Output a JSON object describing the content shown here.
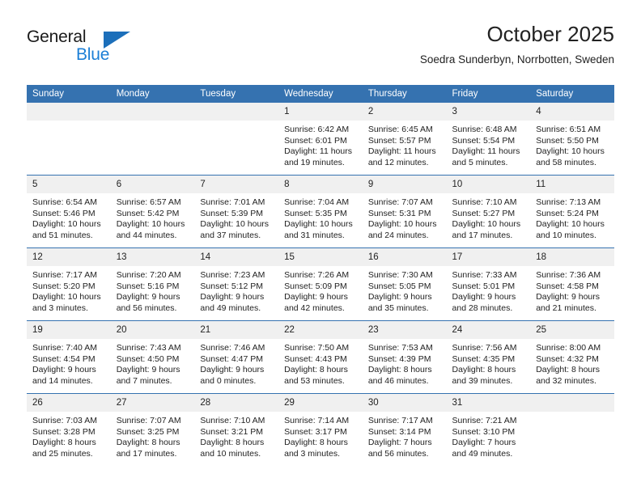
{
  "logo": {
    "word1": "General",
    "word2": "Blue",
    "triangle_color": "#1c6fba",
    "blue_color": "#1c7fd6"
  },
  "header": {
    "month_title": "October 2025",
    "location": "Soedra Sunderbyn, Norrbotten, Sweden"
  },
  "theme": {
    "header_bg": "#3572b0",
    "daynum_bg": "#f0f0f0",
    "text": "#222222"
  },
  "calendar": {
    "weekday_headers": [
      "Sunday",
      "Monday",
      "Tuesday",
      "Wednesday",
      "Thursday",
      "Friday",
      "Saturday"
    ],
    "weeks": [
      [
        {
          "day": "",
          "empty": true,
          "sunrise": "",
          "sunset": "",
          "daylight1": "",
          "daylight2": ""
        },
        {
          "day": "",
          "empty": true,
          "sunrise": "",
          "sunset": "",
          "daylight1": "",
          "daylight2": ""
        },
        {
          "day": "",
          "empty": true,
          "sunrise": "",
          "sunset": "",
          "daylight1": "",
          "daylight2": ""
        },
        {
          "day": "1",
          "sunrise": "Sunrise: 6:42 AM",
          "sunset": "Sunset: 6:01 PM",
          "daylight1": "Daylight: 11 hours",
          "daylight2": "and 19 minutes."
        },
        {
          "day": "2",
          "sunrise": "Sunrise: 6:45 AM",
          "sunset": "Sunset: 5:57 PM",
          "daylight1": "Daylight: 11 hours",
          "daylight2": "and 12 minutes."
        },
        {
          "day": "3",
          "sunrise": "Sunrise: 6:48 AM",
          "sunset": "Sunset: 5:54 PM",
          "daylight1": "Daylight: 11 hours",
          "daylight2": "and 5 minutes."
        },
        {
          "day": "4",
          "sunrise": "Sunrise: 6:51 AM",
          "sunset": "Sunset: 5:50 PM",
          "daylight1": "Daylight: 10 hours",
          "daylight2": "and 58 minutes."
        }
      ],
      [
        {
          "day": "5",
          "sunrise": "Sunrise: 6:54 AM",
          "sunset": "Sunset: 5:46 PM",
          "daylight1": "Daylight: 10 hours",
          "daylight2": "and 51 minutes."
        },
        {
          "day": "6",
          "sunrise": "Sunrise: 6:57 AM",
          "sunset": "Sunset: 5:42 PM",
          "daylight1": "Daylight: 10 hours",
          "daylight2": "and 44 minutes."
        },
        {
          "day": "7",
          "sunrise": "Sunrise: 7:01 AM",
          "sunset": "Sunset: 5:39 PM",
          "daylight1": "Daylight: 10 hours",
          "daylight2": "and 37 minutes."
        },
        {
          "day": "8",
          "sunrise": "Sunrise: 7:04 AM",
          "sunset": "Sunset: 5:35 PM",
          "daylight1": "Daylight: 10 hours",
          "daylight2": "and 31 minutes."
        },
        {
          "day": "9",
          "sunrise": "Sunrise: 7:07 AM",
          "sunset": "Sunset: 5:31 PM",
          "daylight1": "Daylight: 10 hours",
          "daylight2": "and 24 minutes."
        },
        {
          "day": "10",
          "sunrise": "Sunrise: 7:10 AM",
          "sunset": "Sunset: 5:27 PM",
          "daylight1": "Daylight: 10 hours",
          "daylight2": "and 17 minutes."
        },
        {
          "day": "11",
          "sunrise": "Sunrise: 7:13 AM",
          "sunset": "Sunset: 5:24 PM",
          "daylight1": "Daylight: 10 hours",
          "daylight2": "and 10 minutes."
        }
      ],
      [
        {
          "day": "12",
          "sunrise": "Sunrise: 7:17 AM",
          "sunset": "Sunset: 5:20 PM",
          "daylight1": "Daylight: 10 hours",
          "daylight2": "and 3 minutes."
        },
        {
          "day": "13",
          "sunrise": "Sunrise: 7:20 AM",
          "sunset": "Sunset: 5:16 PM",
          "daylight1": "Daylight: 9 hours",
          "daylight2": "and 56 minutes."
        },
        {
          "day": "14",
          "sunrise": "Sunrise: 7:23 AM",
          "sunset": "Sunset: 5:12 PM",
          "daylight1": "Daylight: 9 hours",
          "daylight2": "and 49 minutes."
        },
        {
          "day": "15",
          "sunrise": "Sunrise: 7:26 AM",
          "sunset": "Sunset: 5:09 PM",
          "daylight1": "Daylight: 9 hours",
          "daylight2": "and 42 minutes."
        },
        {
          "day": "16",
          "sunrise": "Sunrise: 7:30 AM",
          "sunset": "Sunset: 5:05 PM",
          "daylight1": "Daylight: 9 hours",
          "daylight2": "and 35 minutes."
        },
        {
          "day": "17",
          "sunrise": "Sunrise: 7:33 AM",
          "sunset": "Sunset: 5:01 PM",
          "daylight1": "Daylight: 9 hours",
          "daylight2": "and 28 minutes."
        },
        {
          "day": "18",
          "sunrise": "Sunrise: 7:36 AM",
          "sunset": "Sunset: 4:58 PM",
          "daylight1": "Daylight: 9 hours",
          "daylight2": "and 21 minutes."
        }
      ],
      [
        {
          "day": "19",
          "sunrise": "Sunrise: 7:40 AM",
          "sunset": "Sunset: 4:54 PM",
          "daylight1": "Daylight: 9 hours",
          "daylight2": "and 14 minutes."
        },
        {
          "day": "20",
          "sunrise": "Sunrise: 7:43 AM",
          "sunset": "Sunset: 4:50 PM",
          "daylight1": "Daylight: 9 hours",
          "daylight2": "and 7 minutes."
        },
        {
          "day": "21",
          "sunrise": "Sunrise: 7:46 AM",
          "sunset": "Sunset: 4:47 PM",
          "daylight1": "Daylight: 9 hours",
          "daylight2": "and 0 minutes."
        },
        {
          "day": "22",
          "sunrise": "Sunrise: 7:50 AM",
          "sunset": "Sunset: 4:43 PM",
          "daylight1": "Daylight: 8 hours",
          "daylight2": "and 53 minutes."
        },
        {
          "day": "23",
          "sunrise": "Sunrise: 7:53 AM",
          "sunset": "Sunset: 4:39 PM",
          "daylight1": "Daylight: 8 hours",
          "daylight2": "and 46 minutes."
        },
        {
          "day": "24",
          "sunrise": "Sunrise: 7:56 AM",
          "sunset": "Sunset: 4:35 PM",
          "daylight1": "Daylight: 8 hours",
          "daylight2": "and 39 minutes."
        },
        {
          "day": "25",
          "sunrise": "Sunrise: 8:00 AM",
          "sunset": "Sunset: 4:32 PM",
          "daylight1": "Daylight: 8 hours",
          "daylight2": "and 32 minutes."
        }
      ],
      [
        {
          "day": "26",
          "sunrise": "Sunrise: 7:03 AM",
          "sunset": "Sunset: 3:28 PM",
          "daylight1": "Daylight: 8 hours",
          "daylight2": "and 25 minutes."
        },
        {
          "day": "27",
          "sunrise": "Sunrise: 7:07 AM",
          "sunset": "Sunset: 3:25 PM",
          "daylight1": "Daylight: 8 hours",
          "daylight2": "and 17 minutes."
        },
        {
          "day": "28",
          "sunrise": "Sunrise: 7:10 AM",
          "sunset": "Sunset: 3:21 PM",
          "daylight1": "Daylight: 8 hours",
          "daylight2": "and 10 minutes."
        },
        {
          "day": "29",
          "sunrise": "Sunrise: 7:14 AM",
          "sunset": "Sunset: 3:17 PM",
          "daylight1": "Daylight: 8 hours",
          "daylight2": "and 3 minutes."
        },
        {
          "day": "30",
          "sunrise": "Sunrise: 7:17 AM",
          "sunset": "Sunset: 3:14 PM",
          "daylight1": "Daylight: 7 hours",
          "daylight2": "and 56 minutes."
        },
        {
          "day": "31",
          "sunrise": "Sunrise: 7:21 AM",
          "sunset": "Sunset: 3:10 PM",
          "daylight1": "Daylight: 7 hours",
          "daylight2": "and 49 minutes."
        },
        {
          "day": "",
          "empty": true,
          "sunrise": "",
          "sunset": "",
          "daylight1": "",
          "daylight2": ""
        }
      ]
    ]
  }
}
